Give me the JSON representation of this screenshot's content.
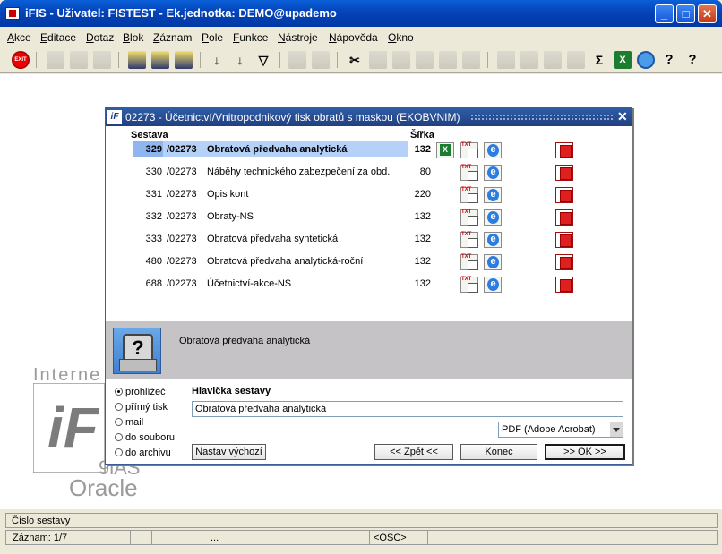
{
  "window": {
    "title": "iFIS - Uživatel: FISTEST - Ek.jednotka: DEMO@upademo",
    "min": "_",
    "max": "□",
    "close": "✕"
  },
  "menu": [
    "Akce",
    "Editace",
    "Dotaz",
    "Blok",
    "Záznam",
    "Pole",
    "Funkce",
    "Nástroje",
    "Nápověda",
    "Okno"
  ],
  "toolbar": {
    "exit_label": "EXIT",
    "icons": [
      "exit-icon",
      "insert-record-icon",
      "duplicate-record-icon",
      "delete-record-icon",
      "enter-query-icon",
      "execute-query-icon",
      "cancel-query-icon",
      "sort-asc-icon",
      "sort-desc-icon",
      "filter-icon",
      "print-icon",
      "print-preview-icon",
      "cut-icon",
      "copy-icon",
      "paste-icon",
      "paste-special-icon",
      "list-icon",
      "tree-icon",
      "calculator-icon",
      "settings-icon",
      "chart-icon",
      "clock-icon",
      "sum-icon",
      "excel-icon",
      "web-icon",
      "help-search-icon",
      "help-icon"
    ]
  },
  "background": {
    "word1": "Interne",
    "word2": "9iAS",
    "word3": "Oracle",
    "logo": "iF"
  },
  "dialog": {
    "title": "02273 - Účetnictví/Vnitropodnikový tisk obratů s maskou (EKOBVNIM)",
    "close": "✕",
    "col_sestava": "Sestava",
    "col_sirka": "Šířka",
    "rows": [
      {
        "num": "329",
        "code": "/02273",
        "name": "Obratová předvaha analytická",
        "width": "132",
        "excel": true
      },
      {
        "num": "330",
        "code": "/02273",
        "name": "Náběhy technického zabezpečení za obd.",
        "width": "80",
        "excel": false
      },
      {
        "num": "331",
        "code": "/02273",
        "name": "Opis kont",
        "width": "220",
        "excel": false
      },
      {
        "num": "332",
        "code": "/02273",
        "name": "Obraty-NS",
        "width": "132",
        "excel": false
      },
      {
        "num": "333",
        "code": "/02273",
        "name": "Obratová předvaha syntetická",
        "width": "132",
        "excel": false
      },
      {
        "num": "480",
        "code": "/02273",
        "name": "Obratová předvaha analytická-roční",
        "width": "132",
        "excel": false
      },
      {
        "num": "688",
        "code": "/02273",
        "name": "Účetnictví-akce-NS",
        "width": "132",
        "excel": false
      }
    ],
    "description": "Obratová předvaha analytická",
    "output_options": [
      "prohlížeč",
      "přímý tisk",
      "mail",
      "do souboru",
      "do archivu"
    ],
    "output_selected": 0,
    "header_label": "Hlavička sestavy",
    "header_value": "Obratová předvaha analytická",
    "format_value": "PDF (Adobe Acrobat)",
    "btn_default": "Nastav výchozí",
    "btn_back": "<< Zpět <<",
    "btn_end": "Konec",
    "btn_ok": ">> OK >>"
  },
  "status": {
    "line1": "Číslo sestavy",
    "record": "Záznam: 1/7",
    "ellipsis": "...",
    "osc": "<OSC>"
  }
}
